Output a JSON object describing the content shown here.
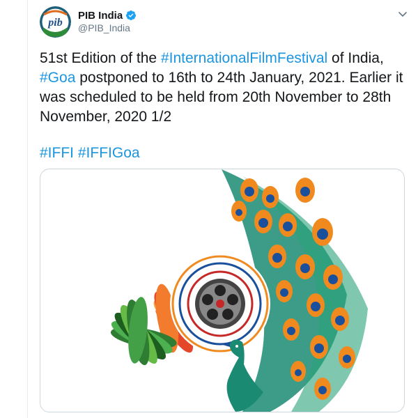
{
  "tweet": {
    "author": {
      "name": "PIB India",
      "handle": "@PIB_India",
      "avatar_label": "pib"
    },
    "text_parts": {
      "p1": "51st Edition of the ",
      "h1": "#InternationalFilmFestival",
      "p2": " of India, ",
      "h2": "#Goa",
      "p3": " postponed to 16th to 24th January, 2021. Earlier it was scheduled to be held from 20th November to 28th November, 2020 1/2"
    },
    "hashtags": [
      "#IFFI",
      "#IFFIGoa"
    ],
    "colors": {
      "link": "#1b95e0",
      "verified": "#1da1f2",
      "secondary": "#657786"
    },
    "icons": {
      "verified": "verified-badge-icon",
      "menu": "chevron-down-icon"
    }
  }
}
